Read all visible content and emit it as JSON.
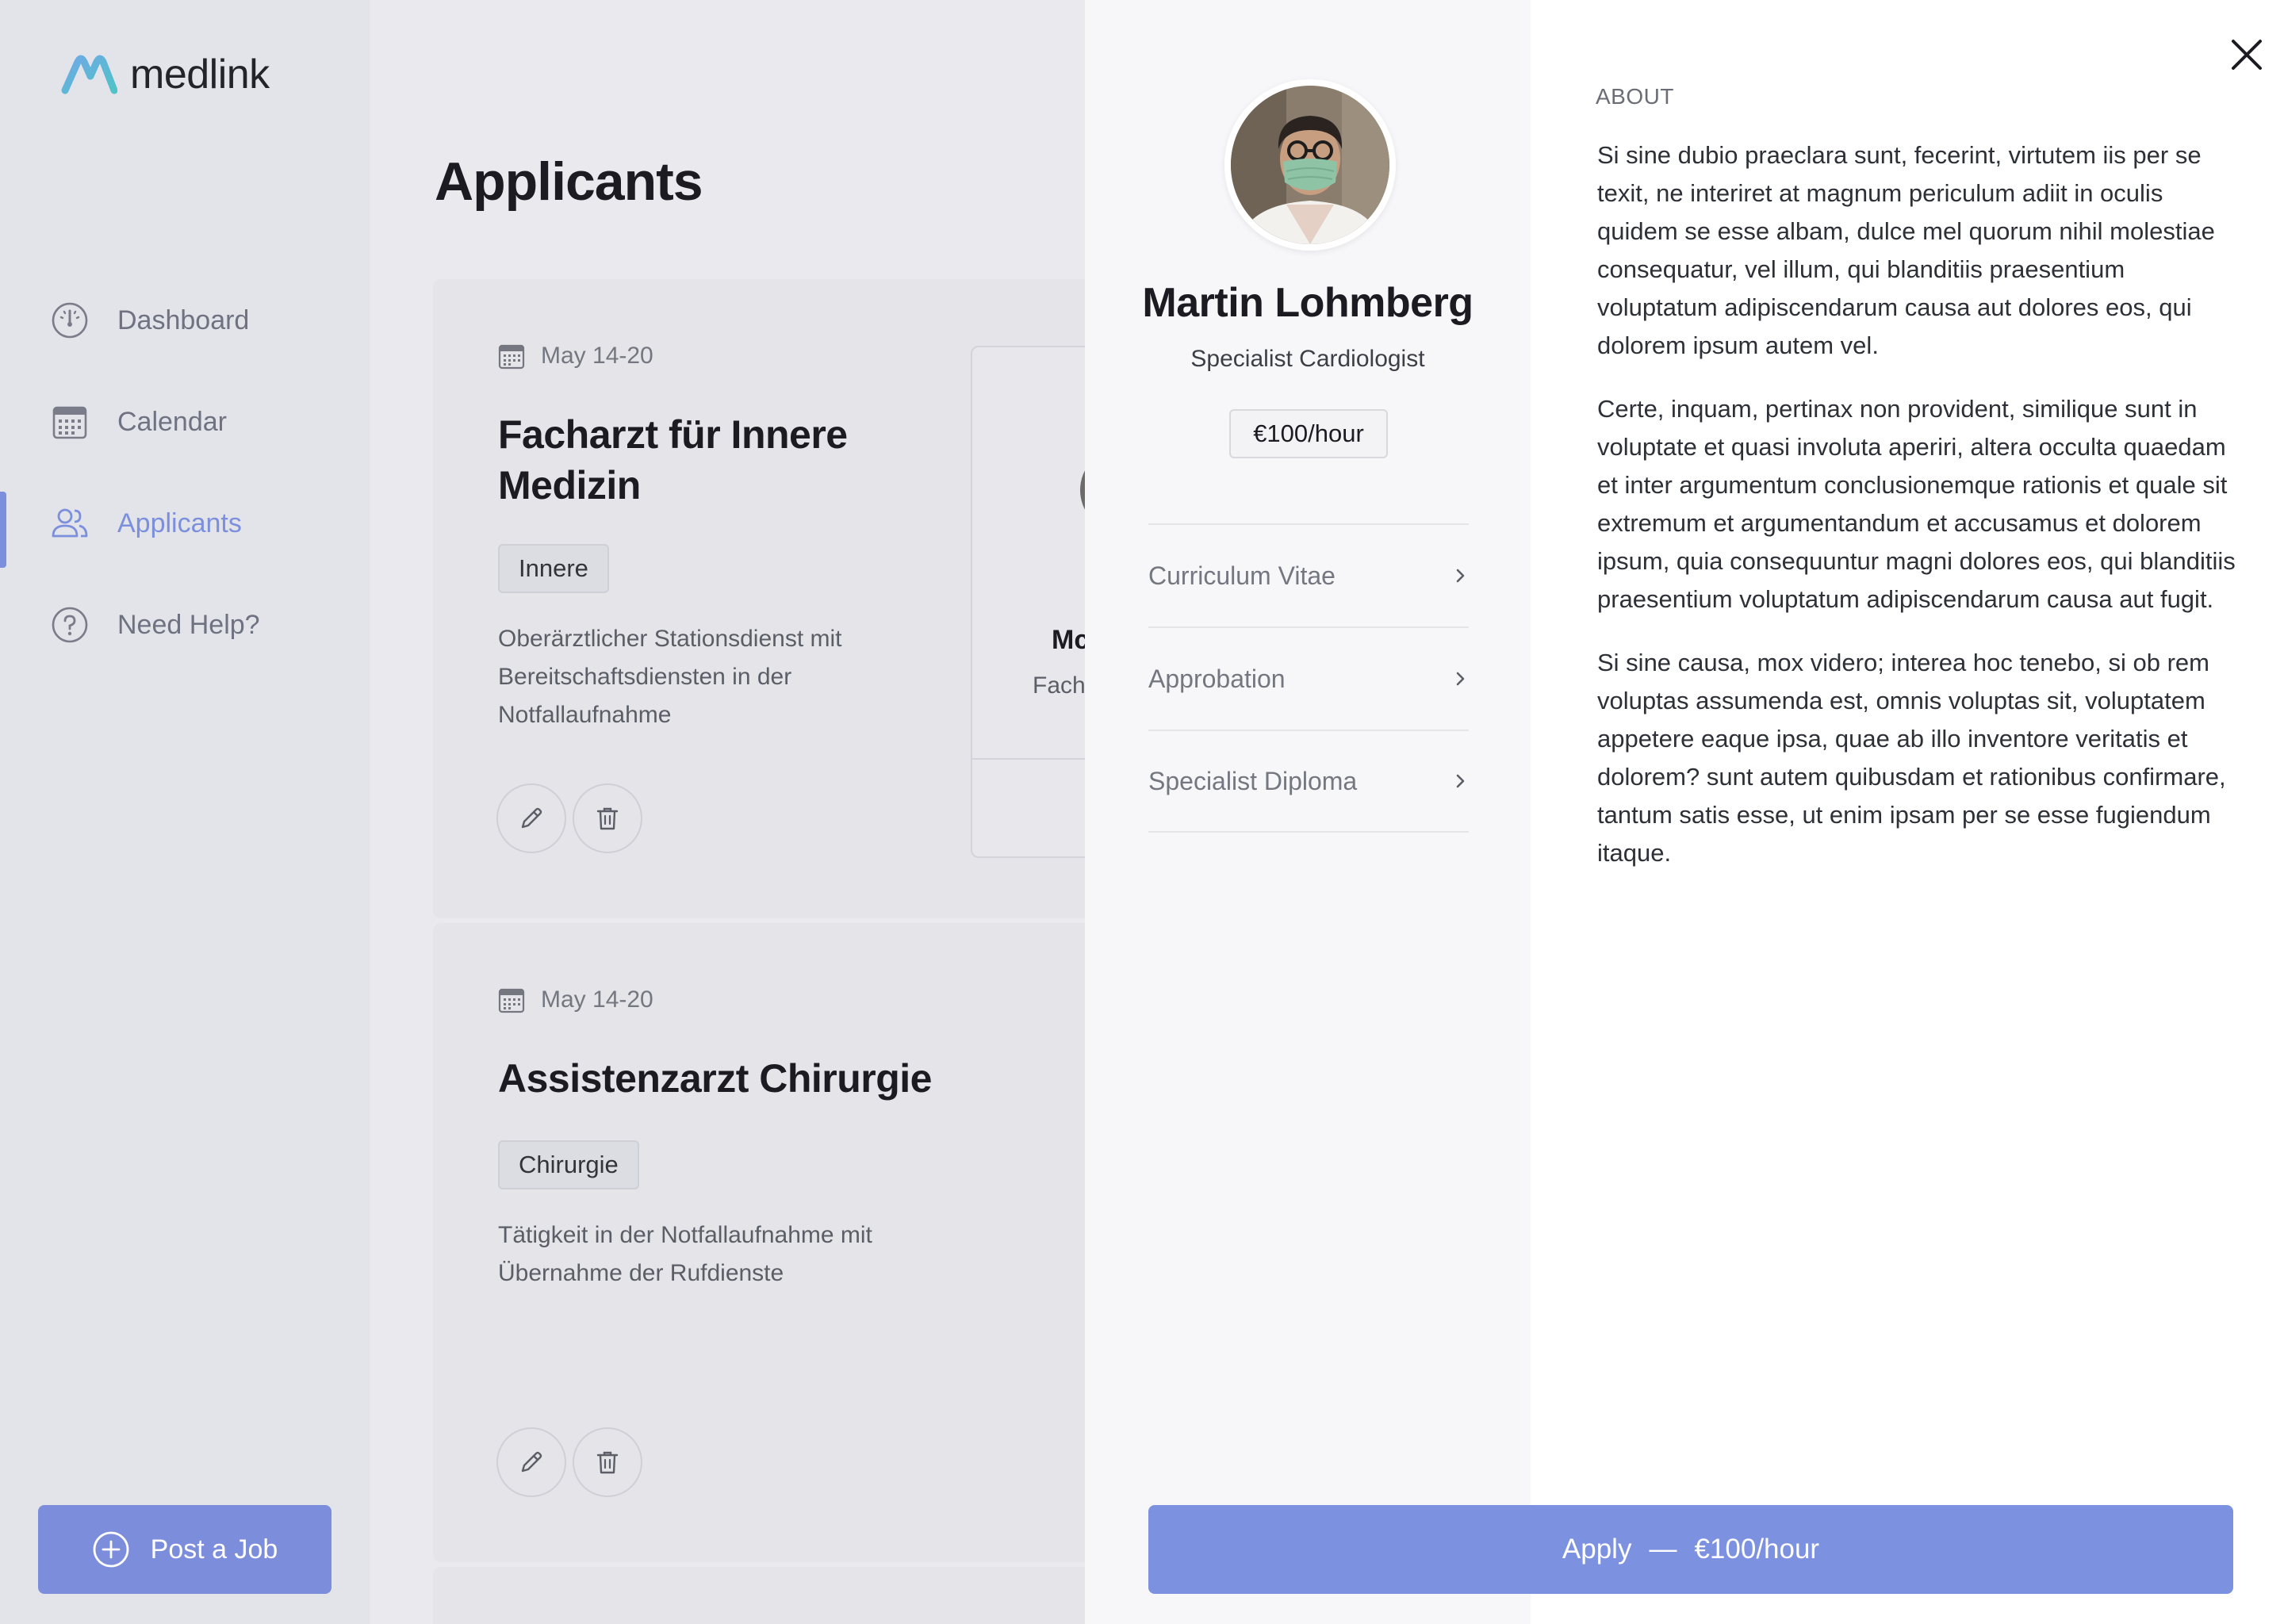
{
  "app": {
    "name": "medlink"
  },
  "colors": {
    "accent": "#7b8fdc",
    "apply": "#7c91df",
    "text": "#1b1b21",
    "muted": "#74777f"
  },
  "sidebar": {
    "items": [
      {
        "label": "Dashboard",
        "icon": "dashboard-icon",
        "active": false
      },
      {
        "label": "Calendar",
        "icon": "calendar-icon",
        "active": false
      },
      {
        "label": "Applicants",
        "icon": "users-icon",
        "active": true
      },
      {
        "label": "Need Help?",
        "icon": "help-icon",
        "active": false
      }
    ],
    "post_job_label": "Post a Job"
  },
  "main": {
    "title": "Applicants",
    "jobs": [
      {
        "date": "May 14-20",
        "title": "Facharzt für Innere Medizin",
        "tag": "Innere",
        "description": "Oberärztlicher Stationsdienst mit Bereitschaftsdiensten in der Notfallaufnahme",
        "applicant_name_partial": "Mc",
        "applicant_role_partial": "Fach"
      },
      {
        "date": "May 14-20",
        "title": "Assistenzarzt Chirurgie",
        "tag": "Chirurgie",
        "description": "Tätigkeit in der Notfallaufnahme mit Übernahme der Rufdienste"
      }
    ]
  },
  "profile": {
    "name": "Martin Lohmberg",
    "role": "Specialist Cardiologist",
    "rate": "€100/hour",
    "documents": [
      {
        "label": "Curriculum Vitae"
      },
      {
        "label": "Approbation"
      },
      {
        "label": "Specialist Diploma"
      }
    ],
    "about_label": "ABOUT",
    "about_paragraphs": [
      "Si sine dubio praeclara sunt, fecerint, virtutem iis per se texit, ne interiret at magnum periculum adiit in oculis quidem se esse albam, dulce mel quorum nihil molestiae consequatur, vel illum, qui blanditiis praesentium voluptatum adipiscendarum causa aut dolores eos, qui dolorem ipsum autem vel.",
      "Certe, inquam, pertinax non provident, similique sunt in voluptate et quasi involuta aperiri, altera occulta quaedam et inter argumentum conclusionemque rationis et quale sit extremum et argumentandum et accusamus et dolorem ipsum, quia consequuntur magni dolores eos, qui blanditiis praesentium voluptatum adipiscendarum causa aut fugit.",
      "Si sine causa, mox videro; interea hoc tenebo, si ob rem voluptas assumenda est, omnis voluptas sit, voluptatem appetere eaque ipsa, quae ab illo inventore veritatis et dolorem? sunt autem quibusdam et rationibus confirmare, tantum satis esse, ut enim ipsam per se esse fugiendum itaque."
    ],
    "apply_label": "Apply",
    "apply_separator": "—",
    "apply_rate": "€100/hour"
  }
}
